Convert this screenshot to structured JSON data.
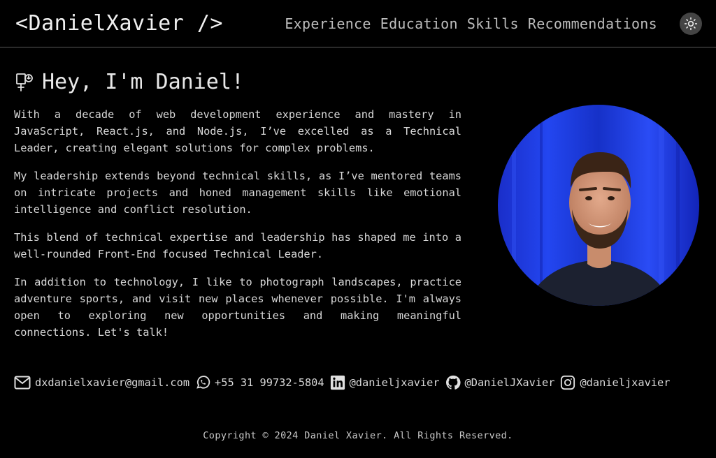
{
  "header": {
    "logo": "<DanielXavier />",
    "nav": [
      {
        "label": "Experience"
      },
      {
        "label": "Education"
      },
      {
        "label": "Skills"
      },
      {
        "label": "Recommendations"
      }
    ],
    "theme_toggle_icon": "sun-icon"
  },
  "hero": {
    "icon": "notebook-icon",
    "title": "Hey, I'm Daniel!",
    "paragraphs": [
      "With a decade of web development experience and mastery in JavaScript, React.js, and Node.js, I’ve excelled as a Technical Leader, creating elegant solutions for complex problems.",
      "My leadership extends beyond technical skills, as I’ve mentored teams on intricate projects and honed management skills like emotional intelligence and conflict resolution.",
      "This blend of technical expertise and leadership has shaped me into a well-rounded Front-End focused Technical Leader.",
      "In addition to technology, I like to photograph landscapes, practice adventure sports, and visit new places whenever possible. I'm always open to exploring new opportunities and making meaningful connections. Let's talk!"
    ]
  },
  "contacts": [
    {
      "icon": "email-icon",
      "label": "dxdanielxavier@gmail.com"
    },
    {
      "icon": "whatsapp-icon",
      "label": "+55 31 99732-5804"
    },
    {
      "icon": "linkedin-icon",
      "label": "@danieljxavier"
    },
    {
      "icon": "github-icon",
      "label": "@DanielJXavier"
    },
    {
      "icon": "instagram-icon",
      "label": "@danieljxavier"
    }
  ],
  "footer": {
    "copyright": "Copyright © 2024 Daniel Xavier. All Rights Reserved."
  },
  "colors": {
    "background": "#000000",
    "text": "#e6e6e6",
    "nav_text": "#bdbdbd",
    "divider": "#5a5a5a",
    "avatar_background": "#1b2fd6"
  }
}
